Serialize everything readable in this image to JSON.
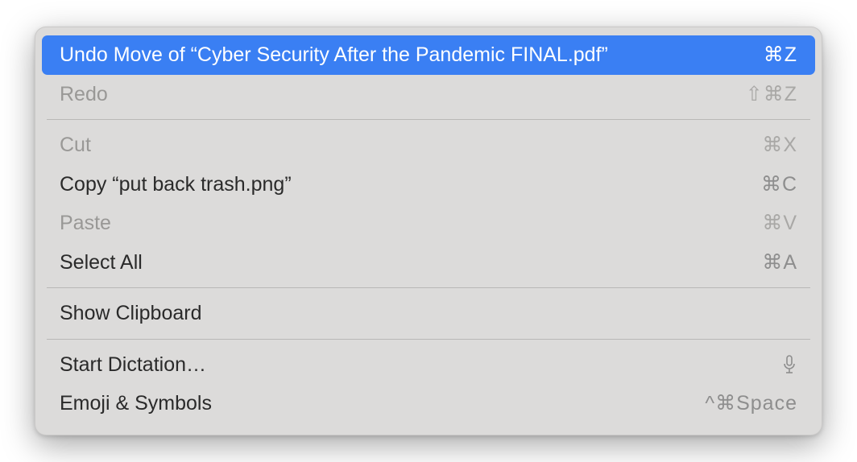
{
  "menu": {
    "items": [
      {
        "label": "Undo Move of “Cyber Security After the Pandemic FINAL.pdf”",
        "shortcut": "⌘Z",
        "state": "highlighted"
      },
      {
        "label": "Redo",
        "shortcut": "⇧⌘Z",
        "state": "disabled"
      }
    ],
    "group2": [
      {
        "label": "Cut",
        "shortcut": "⌘X",
        "state": "disabled"
      },
      {
        "label": "Copy “put back trash.png”",
        "shortcut": "⌘C",
        "state": "enabled"
      },
      {
        "label": "Paste",
        "shortcut": "⌘V",
        "state": "disabled"
      },
      {
        "label": "Select All",
        "shortcut": "⌘A",
        "state": "enabled"
      }
    ],
    "group3": [
      {
        "label": "Show Clipboard",
        "shortcut": "",
        "state": "enabled"
      }
    ],
    "group4": [
      {
        "label": "Start Dictation…",
        "shortcut": "mic",
        "state": "enabled"
      },
      {
        "label": "Emoji & Symbols",
        "shortcut": "^⌘Space",
        "state": "enabled"
      }
    ]
  }
}
